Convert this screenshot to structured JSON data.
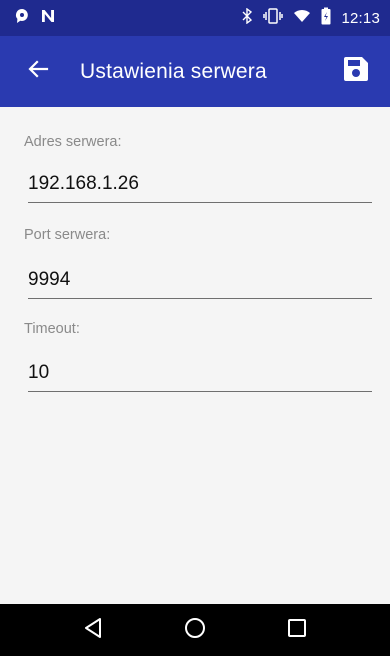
{
  "status_bar": {
    "time": "12:13",
    "icons": [
      "notification-bubble-icon",
      "n-icon",
      "bluetooth-icon",
      "vibrate-icon",
      "wifi-icon",
      "battery-icon"
    ]
  },
  "app_bar": {
    "title": "Ustawienia serwera",
    "back_icon": "arrow-back-icon",
    "save_icon": "floppy-save-icon"
  },
  "form": {
    "server_address": {
      "label": "Adres serwera:",
      "value": "192.168.1.26"
    },
    "server_port": {
      "label": "Port serwera:",
      "value": "9994"
    },
    "timeout": {
      "label": "Timeout:",
      "value": "10"
    }
  },
  "navigation": {
    "icons": [
      "back-triangle-icon",
      "home-circle-icon",
      "recents-square-icon"
    ]
  },
  "colors": {
    "status_bar": "#1f2a8f",
    "app_bar": "#2a3ab0",
    "background": "#f5f5f5",
    "nav_bar": "#000000"
  }
}
